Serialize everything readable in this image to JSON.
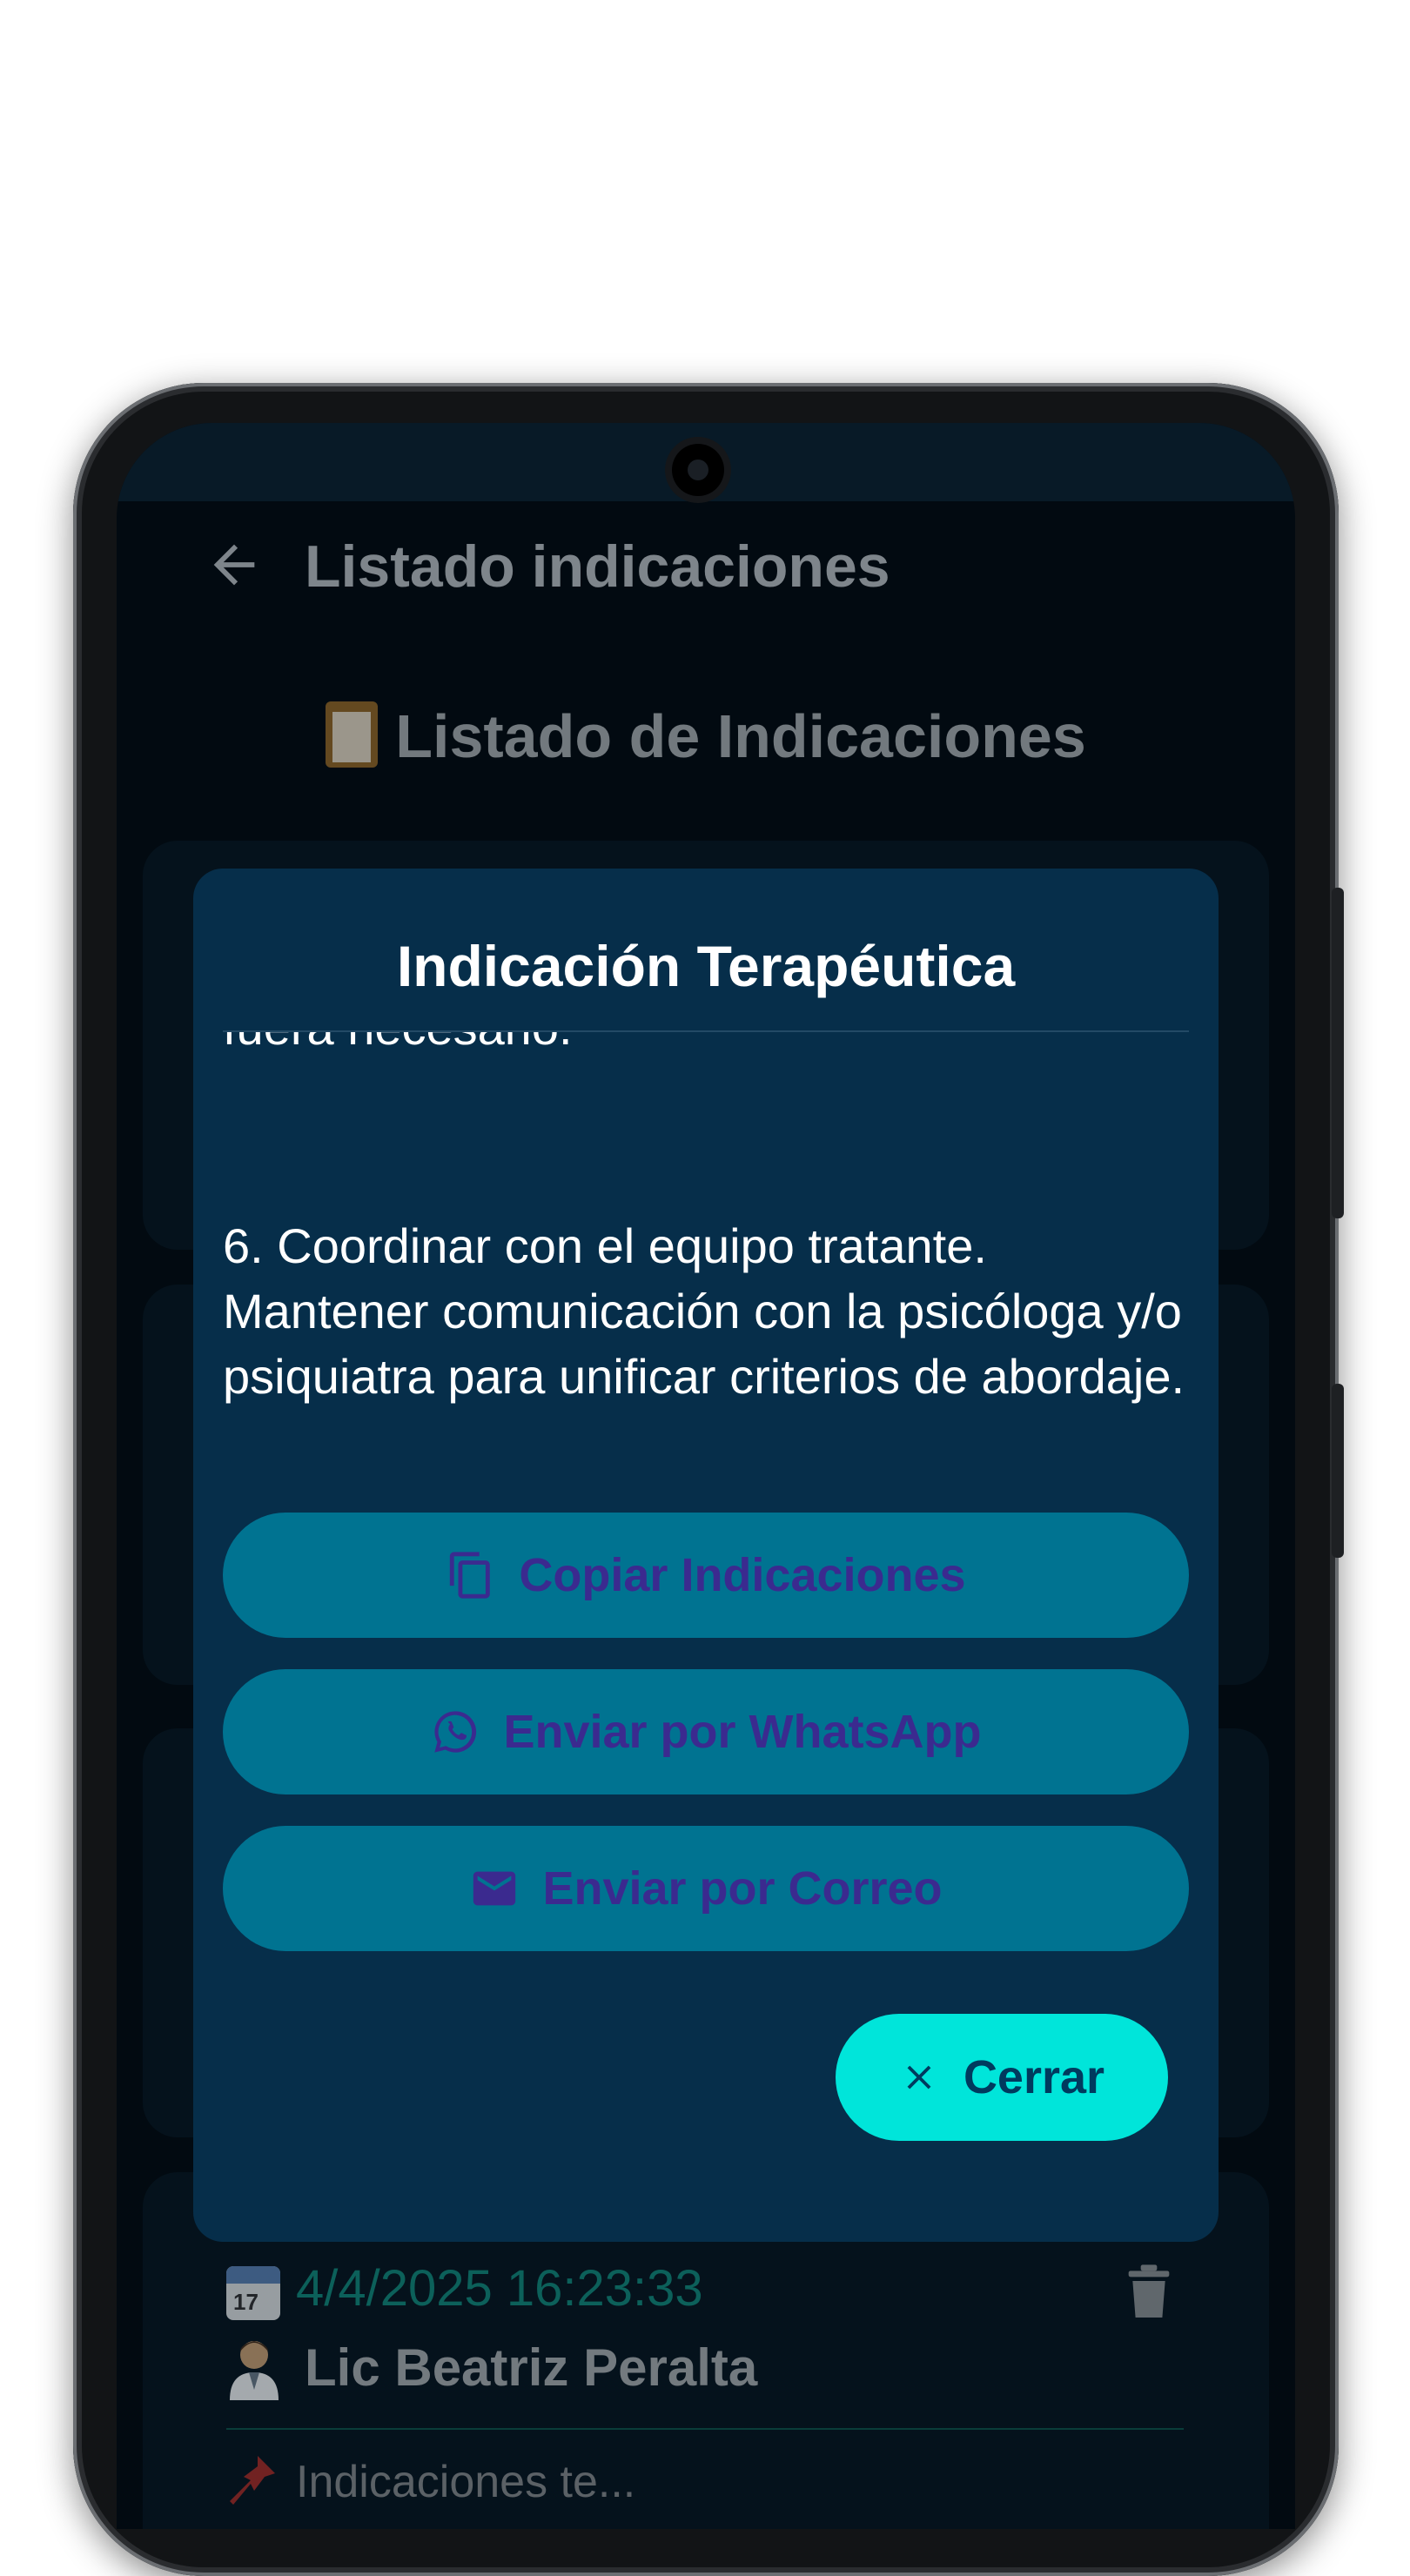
{
  "appbar": {
    "title": "Listado indicaciones"
  },
  "list": {
    "heading": "Listado de Indicaciones",
    "item": {
      "date": "4/4/2025 16:23:33",
      "calendar_day": "17",
      "doctor": "Lic Beatriz Peralta",
      "snippet": "Indicaciones te..."
    }
  },
  "dialog": {
    "title": "Indicación Terapéutica",
    "cut_text": "fuera necesario.",
    "paragraph": "6. Coordinar con el equipo tratante. Mantener comunicación con la psicóloga y/o psiquiatra para unificar criterios de abordaje.",
    "buttons": {
      "copy": "Copiar Indicaciones",
      "whatsapp": "Enviar por WhatsApp",
      "email": "Enviar por Correo",
      "close": "Cerrar"
    }
  },
  "colors": {
    "dialog_bg": "#062e4a",
    "action_button": "#007391",
    "action_text": "#3b2a8f",
    "close_button": "#00e5da",
    "date_text": "#0f766e"
  },
  "icons": [
    "back-arrow-icon",
    "clipboard-icon",
    "copy-icon",
    "whatsapp-icon",
    "mail-icon",
    "close-icon",
    "calendar-icon",
    "trash-icon",
    "person-icon",
    "pin-icon"
  ]
}
